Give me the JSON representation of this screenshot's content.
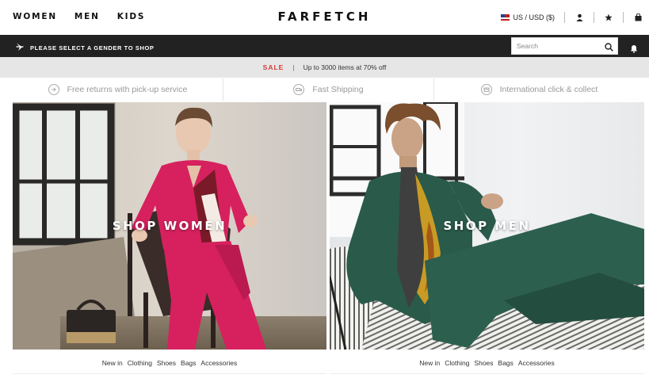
{
  "header": {
    "nav": [
      "WOMEN",
      "MEN",
      "KIDS"
    ],
    "logo": "FARFETCH",
    "locale": "US / USD ($)"
  },
  "gender_bar": {
    "message": "PLEASE SELECT A GENDER TO SHOP",
    "search_placeholder": "Search"
  },
  "sale_bar": {
    "sale_label": "SALE",
    "separator": "|",
    "text": "Up to 3000 items at 70% off"
  },
  "perks": [
    {
      "icon": "returns-icon",
      "label": "Free returns with pick-up service"
    },
    {
      "icon": "shipping-icon",
      "label": "Fast Shipping"
    },
    {
      "icon": "click-collect-icon",
      "label": "International click & collect"
    }
  ],
  "heroes": [
    {
      "label": "SHOP WOMEN",
      "links": [
        "New in",
        "Clothing",
        "Shoes",
        "Bags",
        "Accessories"
      ]
    },
    {
      "label": "SHOP MEN",
      "links": [
        "New in",
        "Clothing",
        "Shoes",
        "Bags",
        "Accessories"
      ]
    }
  ],
  "colors": {
    "sale_red": "#d63a3a",
    "dark_bar": "#222222",
    "sale_bar_bg": "#e6e6e6",
    "women_outfit": "#d6215e",
    "men_suit": "#2a5a4a"
  }
}
